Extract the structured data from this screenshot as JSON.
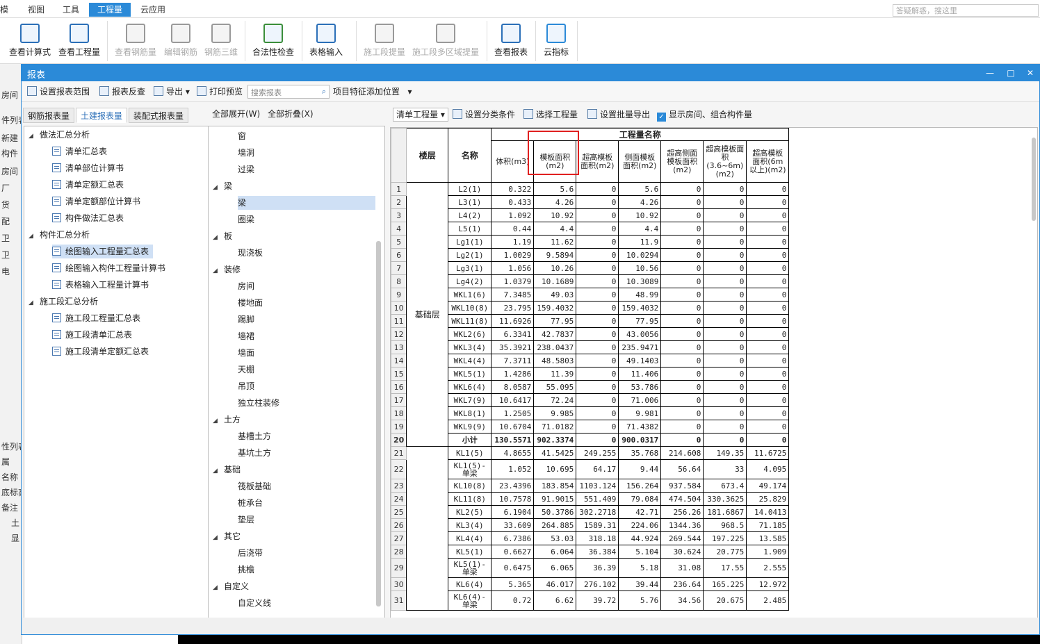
{
  "menubar": {
    "items": [
      "模",
      "视图",
      "工具",
      "工程量",
      "云应用"
    ],
    "help_placeholder": "答疑解惑，搜这里"
  },
  "ribbon": {
    "buttons": [
      {
        "label": "查看计算式",
        "disabled": false
      },
      {
        "label": "查看工程量",
        "disabled": false
      },
      {
        "label": "查看钢筋量",
        "disabled": true
      },
      {
        "label": "编辑钢筋",
        "disabled": true
      },
      {
        "label": "钢筋三维",
        "disabled": true
      },
      {
        "label": "合法性检查",
        "disabled": false
      },
      {
        "label": "表格输入",
        "disabled": false
      },
      {
        "label": "施工段提量",
        "disabled": true
      },
      {
        "label": "施工段多区域提量",
        "disabled": true
      },
      {
        "label": "查看报表",
        "disabled": false
      },
      {
        "label": "云指标",
        "disabled": false
      }
    ]
  },
  "background_left": [
    "房间",
    "件列表",
    "新建",
    "构件",
    "房间",
    "厂",
    "货",
    "配",
    "卫",
    "卫",
    "电",
    "性列表",
    "属",
    "名称",
    "底标高",
    "备注",
    "土",
    "显"
  ],
  "window": {
    "title": "报表",
    "minimize": "—",
    "restore": "□",
    "close": "✕"
  },
  "toolbar": {
    "set_range": "设置报表范围",
    "reverse_check": "报表反查",
    "export": "导出",
    "print_preview": "打印预览",
    "search_placeholder": "搜索报表",
    "add_feature_position": "项目特征添加位置"
  },
  "tabs": [
    "钢筋报表量",
    "土建报表量",
    "装配式报表量"
  ],
  "tree": {
    "groups": [
      {
        "label": "做法汇总分析",
        "items": [
          "清单汇总表",
          "清单部位计算书",
          "清单定额汇总表",
          "清单定额部位计算书",
          "构件做法汇总表"
        ]
      },
      {
        "label": "构件汇总分析",
        "items": [
          "绘图输入工程量汇总表",
          "绘图输入构件工程量计算书",
          "表格输入工程量计算书"
        ]
      },
      {
        "label": "施工段汇总分析",
        "items": [
          "施工段工程量汇总表",
          "施工段清单汇总表",
          "施工段清单定额汇总表"
        ]
      }
    ],
    "selected": "绘图输入工程量汇总表"
  },
  "middle": {
    "expand_all": "全部展开(W)",
    "collapse_all": "全部折叠(X)",
    "nodes": [
      {
        "label": "窗",
        "level": 2
      },
      {
        "label": "墙洞",
        "level": 2
      },
      {
        "label": "过梁",
        "level": 2
      },
      {
        "label": "梁",
        "level": 1
      },
      {
        "label": "梁",
        "level": 2,
        "selected": true
      },
      {
        "label": "圈梁",
        "level": 2
      },
      {
        "label": "板",
        "level": 1
      },
      {
        "label": "现浇板",
        "level": 2
      },
      {
        "label": "装修",
        "level": 1
      },
      {
        "label": "房间",
        "level": 2
      },
      {
        "label": "楼地面",
        "level": 2
      },
      {
        "label": "踢脚",
        "level": 2
      },
      {
        "label": "墙裙",
        "level": 2
      },
      {
        "label": "墙面",
        "level": 2
      },
      {
        "label": "天棚",
        "level": 2
      },
      {
        "label": "吊顶",
        "level": 2
      },
      {
        "label": "独立柱装修",
        "level": 2
      },
      {
        "label": "土方",
        "level": 1
      },
      {
        "label": "基槽土方",
        "level": 2
      },
      {
        "label": "基坑土方",
        "level": 2
      },
      {
        "label": "基础",
        "level": 1
      },
      {
        "label": "筏板基础",
        "level": 2
      },
      {
        "label": "桩承台",
        "level": 2
      },
      {
        "label": "垫层",
        "level": 2
      },
      {
        "label": "其它",
        "level": 1
      },
      {
        "label": "后浇带",
        "level": 2
      },
      {
        "label": "挑檐",
        "level": 2
      },
      {
        "label": "自定义",
        "level": 1
      },
      {
        "label": "自定义线",
        "level": 2
      }
    ]
  },
  "report_toolbar": {
    "mode": "清单工程量",
    "set_category": "设置分类条件",
    "select_quantity": "选择工程量",
    "batch_export": "设置批量导出",
    "show_rooms": "显示房间、组合构件量"
  },
  "table": {
    "group_header": "工程量名称",
    "col_floor": "楼层",
    "col_name": "名称",
    "cols": [
      "体积(m3)",
      "模板面积(m2)",
      "超高模板面积(m2)",
      "侧面模板面积(m2)",
      "超高侧面模板面积(m2)",
      "超高模板面积(3.6~6m)(m2)",
      "超高模板面积(6m以上)(m2)"
    ],
    "floor_label": "基础层",
    "rows": [
      {
        "n": "1",
        "name": "L2(1)",
        "v": [
          "0.322",
          "5.6",
          "0",
          "5.6",
          "0",
          "0",
          "0"
        ]
      },
      {
        "n": "2",
        "name": "L3(1)",
        "v": [
          "0.433",
          "4.26",
          "0",
          "4.26",
          "0",
          "0",
          "0"
        ]
      },
      {
        "n": "3",
        "name": "L4(2)",
        "v": [
          "1.092",
          "10.92",
          "0",
          "10.92",
          "0",
          "0",
          "0"
        ]
      },
      {
        "n": "4",
        "name": "L5(1)",
        "v": [
          "0.44",
          "4.4",
          "0",
          "4.4",
          "0",
          "0",
          "0"
        ]
      },
      {
        "n": "5",
        "name": "Lg1(1)",
        "v": [
          "1.19",
          "11.62",
          "0",
          "11.9",
          "0",
          "0",
          "0"
        ]
      },
      {
        "n": "6",
        "name": "Lg2(1)",
        "v": [
          "1.0029",
          "9.5894",
          "0",
          "10.0294",
          "0",
          "0",
          "0"
        ]
      },
      {
        "n": "7",
        "name": "Lg3(1)",
        "v": [
          "1.056",
          "10.26",
          "0",
          "10.56",
          "0",
          "0",
          "0"
        ]
      },
      {
        "n": "8",
        "name": "Lg4(2)",
        "v": [
          "1.0379",
          "10.1689",
          "0",
          "10.3089",
          "0",
          "0",
          "0"
        ]
      },
      {
        "n": "9",
        "name": "WKL1(6)",
        "v": [
          "7.3485",
          "49.03",
          "0",
          "48.99",
          "0",
          "0",
          "0"
        ]
      },
      {
        "n": "10",
        "name": "WKL10(8)",
        "v": [
          "23.795",
          "159.4032",
          "0",
          "159.4032",
          "0",
          "0",
          "0"
        ]
      },
      {
        "n": "11",
        "name": "WKL11(8)",
        "v": [
          "11.6926",
          "77.95",
          "0",
          "77.95",
          "0",
          "0",
          "0"
        ]
      },
      {
        "n": "12",
        "name": "WKL2(6)",
        "v": [
          "6.3341",
          "42.7837",
          "0",
          "43.0056",
          "0",
          "0",
          "0"
        ]
      },
      {
        "n": "13",
        "name": "WKL3(4)",
        "v": [
          "35.3921",
          "238.0437",
          "0",
          "235.9471",
          "0",
          "0",
          "0"
        ]
      },
      {
        "n": "14",
        "name": "WKL4(4)",
        "v": [
          "7.3711",
          "48.5803",
          "0",
          "49.1403",
          "0",
          "0",
          "0"
        ]
      },
      {
        "n": "15",
        "name": "WKL5(1)",
        "v": [
          "1.4286",
          "11.39",
          "0",
          "11.406",
          "0",
          "0",
          "0"
        ]
      },
      {
        "n": "16",
        "name": "WKL6(4)",
        "v": [
          "8.0587",
          "55.095",
          "0",
          "53.786",
          "0",
          "0",
          "0"
        ]
      },
      {
        "n": "17",
        "name": "WKL7(9)",
        "v": [
          "10.6417",
          "72.24",
          "0",
          "71.006",
          "0",
          "0",
          "0"
        ]
      },
      {
        "n": "18",
        "name": "WKL8(1)",
        "v": [
          "1.2505",
          "9.985",
          "0",
          "9.981",
          "0",
          "0",
          "0"
        ]
      },
      {
        "n": "19",
        "name": "WKL9(9)",
        "v": [
          "10.6704",
          "71.0182",
          "0",
          "71.4382",
          "0",
          "0",
          "0"
        ]
      },
      {
        "n": "20",
        "name": "小计",
        "v": [
          "130.5571",
          "902.3374",
          "0",
          "900.0317",
          "0",
          "0",
          "0"
        ],
        "subtotal": true
      },
      {
        "n": "21",
        "name": "KL1(5)",
        "v": [
          "4.8655",
          "41.5425",
          "249.255",
          "35.768",
          "214.608",
          "149.35",
          "11.6725"
        ]
      },
      {
        "n": "22",
        "name": "KL1(5)-单梁",
        "v": [
          "1.052",
          "10.695",
          "64.17",
          "9.44",
          "56.64",
          "33",
          "4.095"
        ],
        "tall": true
      },
      {
        "n": "23",
        "name": "KL10(8)",
        "v": [
          "23.4396",
          "183.854",
          "1103.124",
          "156.264",
          "937.584",
          "673.4",
          "49.174"
        ]
      },
      {
        "n": "24",
        "name": "KL11(8)",
        "v": [
          "10.7578",
          "91.9015",
          "551.409",
          "79.084",
          "474.504",
          "330.3625",
          "25.829"
        ]
      },
      {
        "n": "25",
        "name": "KL2(5)",
        "v": [
          "6.1904",
          "50.3786",
          "302.2718",
          "42.71",
          "256.26",
          "181.6867",
          "14.0413"
        ]
      },
      {
        "n": "26",
        "name": "KL3(4)",
        "v": [
          "33.609",
          "264.885",
          "1589.31",
          "224.06",
          "1344.36",
          "968.5",
          "71.185"
        ]
      },
      {
        "n": "27",
        "name": "KL4(4)",
        "v": [
          "6.7386",
          "53.03",
          "318.18",
          "44.924",
          "269.544",
          "197.225",
          "13.585"
        ]
      },
      {
        "n": "28",
        "name": "KL5(1)",
        "v": [
          "0.6627",
          "6.064",
          "36.384",
          "5.104",
          "30.624",
          "20.775",
          "1.909"
        ]
      },
      {
        "n": "29",
        "name": "KL5(1)-单梁",
        "v": [
          "0.6475",
          "6.065",
          "36.39",
          "5.18",
          "31.08",
          "17.55",
          "2.555"
        ],
        "tall": true
      },
      {
        "n": "30",
        "name": "KL6(4)",
        "v": [
          "5.365",
          "46.017",
          "276.102",
          "39.44",
          "236.64",
          "165.225",
          "12.972"
        ]
      },
      {
        "n": "31",
        "name": "KL6(4)-单梁",
        "v": [
          "0.72",
          "6.62",
          "39.72",
          "5.76",
          "34.56",
          "20.675",
          "2.485"
        ],
        "tall": true
      }
    ]
  },
  "colors": {
    "accent": "#2b8ad8",
    "highlight": "#e02020",
    "selected": "#cfe0f5"
  }
}
